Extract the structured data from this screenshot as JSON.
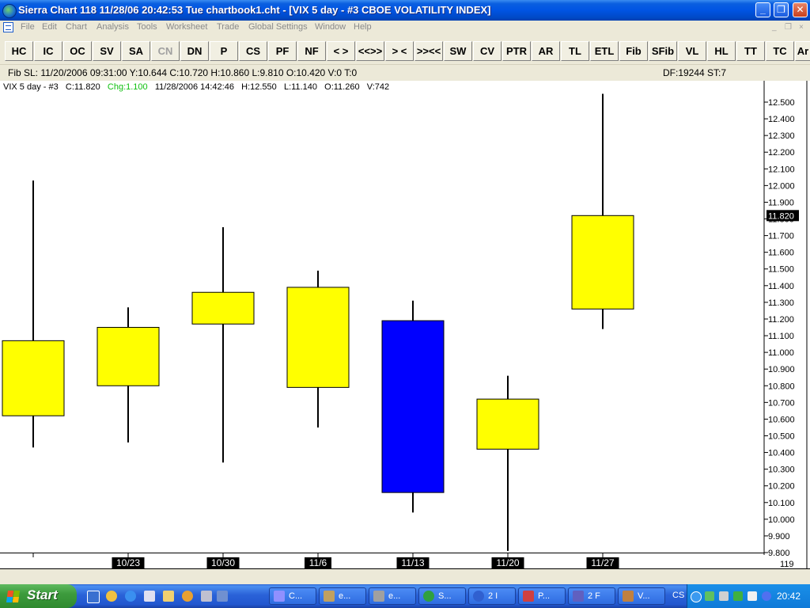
{
  "window": {
    "title": "Sierra Chart 118  11/28/06  20:42:53  Tue    chartbook1.cht - [VIX  5 day  - #3 CBOE VOLATILITY INDEX]",
    "controls": [
      "minimize",
      "restore",
      "close"
    ]
  },
  "menu": {
    "items": [
      "File",
      "Edit",
      "Chart",
      "Analysis",
      "Tools",
      "Worksheet",
      "Trade",
      "Global Settings",
      "Window",
      "Help"
    ],
    "mdi_controls": [
      "_",
      "❐",
      "×"
    ]
  },
  "toolbar": {
    "buttons": [
      {
        "label": "HC"
      },
      {
        "label": "IC"
      },
      {
        "label": "OC"
      },
      {
        "label": "SV"
      },
      {
        "label": "SA"
      },
      {
        "label": "CN",
        "disabled": true
      },
      {
        "label": "DN"
      },
      {
        "label": "P"
      },
      {
        "label": "CS"
      },
      {
        "label": "PF"
      },
      {
        "label": "NF"
      },
      {
        "label": "< >"
      },
      {
        "label": "<<>>"
      },
      {
        "label": "> <"
      },
      {
        "label": ">><<"
      },
      {
        "label": "SW"
      },
      {
        "label": "CV"
      },
      {
        "label": "PTR"
      },
      {
        "label": "AR"
      },
      {
        "label": "TL"
      },
      {
        "label": "ETL"
      },
      {
        "label": "Fib"
      },
      {
        "label": "SFib"
      },
      {
        "label": "VL"
      },
      {
        "label": "HL"
      },
      {
        "label": "TT"
      },
      {
        "label": "TC"
      },
      {
        "label": "Ar"
      }
    ]
  },
  "info_bar": {
    "left": "Fib SL:  11/20/2006  09:31:00   Y:10.644   C:10.720   H:10.860   L:9.810   O:10.420   V:0   T:0",
    "right": "DF:19244   ST:7"
  },
  "chart_header": {
    "symbol": "VIX 5 day - #3",
    "close": "C:11.820",
    "change": "Chg:1.100",
    "timestamp": "11/28/2006  14:42:46",
    "high": "H:12.550",
    "low": "L:11.140",
    "open": "O:11.260",
    "volume": "V:742"
  },
  "chart_data": {
    "type": "candlestick",
    "title": "VIX 5 day - #3 CBOE VOLATILITY INDEX",
    "candles": [
      {
        "label": "",
        "open": 10.62,
        "high": 12.03,
        "low": 10.43,
        "close": 11.07
      },
      {
        "label": "10/23",
        "open": 10.8,
        "high": 11.27,
        "low": 10.46,
        "close": 11.15
      },
      {
        "label": "10/30",
        "open": 11.17,
        "high": 11.75,
        "low": 10.34,
        "close": 11.36
      },
      {
        "label": "11/6",
        "open": 10.79,
        "high": 11.49,
        "low": 10.55,
        "close": 11.39
      },
      {
        "label": "11/13",
        "open": 11.19,
        "high": 11.31,
        "low": 10.04,
        "close": 10.16
      },
      {
        "label": "11/20",
        "open": 10.42,
        "high": 10.86,
        "low": 9.81,
        "close": 10.72
      },
      {
        "label": "11/27",
        "open": 11.26,
        "high": 12.55,
        "low": 11.14,
        "close": 11.82
      }
    ],
    "up_color": "#ffff00",
    "down_color": "#0000ff",
    "background": "#ffffff",
    "ylim": [
      9.8,
      12.5
    ],
    "y_ticks": [
      "12.500",
      "12.400",
      "12.300",
      "12.200",
      "12.100",
      "12.000",
      "11.900",
      "11.800",
      "11.700",
      "11.600",
      "11.500",
      "11.400",
      "11.300",
      "11.200",
      "11.100",
      "11.000",
      "10.900",
      "10.800",
      "10.700",
      "10.600",
      "10.500",
      "10.400",
      "10.300",
      "10.200",
      "10.100",
      "10.000",
      "9.900",
      "9.800"
    ],
    "last_price": "11.820",
    "bar_count": "119"
  },
  "taskbar": {
    "start": "Start",
    "quick_launch": [
      "desktop-icon",
      "clock-app-icon",
      "ie-icon",
      "doc-icon",
      "folder-icon",
      "media-icon",
      "tool-icon"
    ],
    "tasks": [
      {
        "label": "C...",
        "icon": "#9090ff"
      },
      {
        "label": "e...",
        "icon": "#c0a060"
      },
      {
        "label": "e...",
        "icon": "#a0a0a0"
      },
      {
        "label": "S...",
        "icon": "#30a040"
      },
      {
        "label": "2 I",
        "icon": "#3060d0"
      },
      {
        "label": "P...",
        "icon": "#d04040"
      },
      {
        "label": "2 F",
        "icon": "#6060c0"
      },
      {
        "label": "V...",
        "icon": "#c08040"
      }
    ],
    "language": "CS",
    "clock": "20:42"
  }
}
